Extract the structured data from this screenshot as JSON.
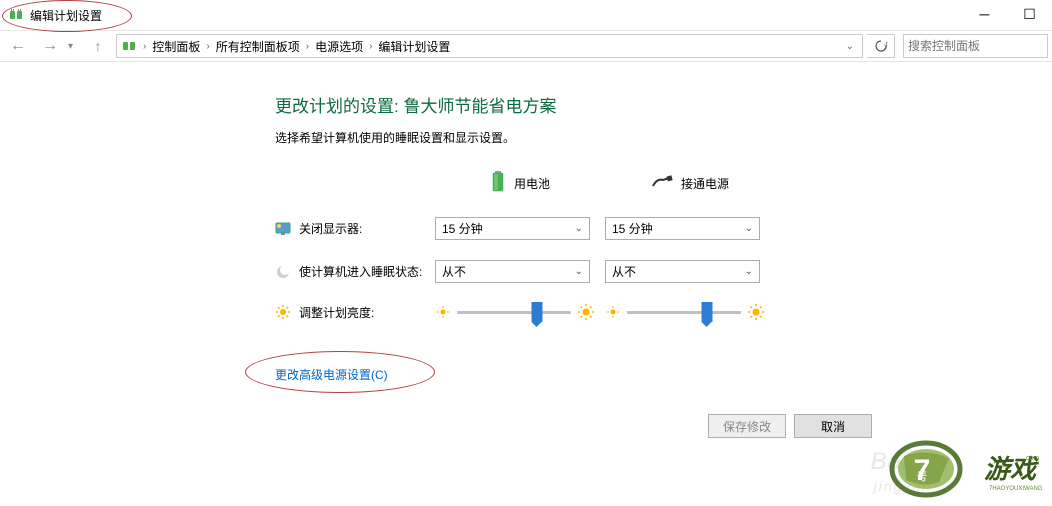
{
  "titlebar": {
    "title": "编辑计划设置"
  },
  "breadcrumb": {
    "items": [
      "控制面板",
      "所有控制面板项",
      "电源选项",
      "编辑计划设置"
    ]
  },
  "search": {
    "placeholder": "搜索控制面板"
  },
  "page": {
    "heading": "更改计划的设置: 鲁大师节能省电方案",
    "subheading": "选择希望计算机使用的睡眠设置和显示设置。"
  },
  "columns": {
    "battery": "用电池",
    "plugged": "接通电源"
  },
  "rows": {
    "display_off": "关闭显示器:",
    "sleep": "使计算机进入睡眠状态:",
    "brightness": "调整计划亮度:"
  },
  "settings": {
    "display_off_battery": "15 分钟",
    "display_off_plugged": "15 分钟",
    "sleep_battery": "从不",
    "sleep_plugged": "从不",
    "brightness_battery_pct": 70,
    "brightness_plugged_pct": 70
  },
  "advanced_link": "更改高级电源设置(C)",
  "buttons": {
    "save": "保存修改",
    "cancel": "取消"
  },
  "watermark": {
    "main": "Baidu",
    "sub": "jingyan"
  }
}
